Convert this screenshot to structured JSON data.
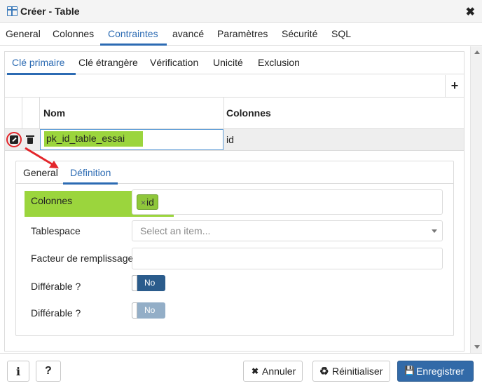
{
  "window": {
    "title": "Créer - Table",
    "close_glyph": "✖"
  },
  "top_tabs": [
    "General",
    "Colonnes",
    "Contraintes",
    "avancé",
    "Paramètres",
    "Sécurité",
    "SQL"
  ],
  "sub_tabs": [
    "Clé primaire",
    "Clé étrangère",
    "Vérification",
    "Unicité",
    "Exclusion"
  ],
  "grid": {
    "add_glyph": "+",
    "headers": {
      "name": "Nom",
      "columns": "Colonnes"
    },
    "row": {
      "name_value": "pk_id_table_essai",
      "columns_value": "id"
    }
  },
  "detail": {
    "tabs": [
      "General",
      "Définition"
    ],
    "fields": {
      "columns_label": "Colonnes",
      "column_chip_x": "×",
      "column_chip": "id",
      "tablespace_label": "Tablespace",
      "tablespace_placeholder": "Select an item...",
      "fillfactor_label": "Facteur de remplissage",
      "deferrable_label": "Différable ?",
      "deferrable_value": "No",
      "deferred_label": "Différable ?",
      "deferred_value": "No"
    }
  },
  "footer": {
    "info_glyph": "i",
    "help_glyph": "?",
    "cancel": "Annuler",
    "cancel_icon": "✖",
    "reset": "Réinitialiser",
    "reset_icon": "♻",
    "save": "Enregistrer",
    "save_icon": "💾"
  },
  "colors": {
    "accent": "#2c6bb3",
    "highlight_green": "#9bd53d",
    "annotation_red": "#e3262b",
    "save_button": "#326aa8"
  }
}
